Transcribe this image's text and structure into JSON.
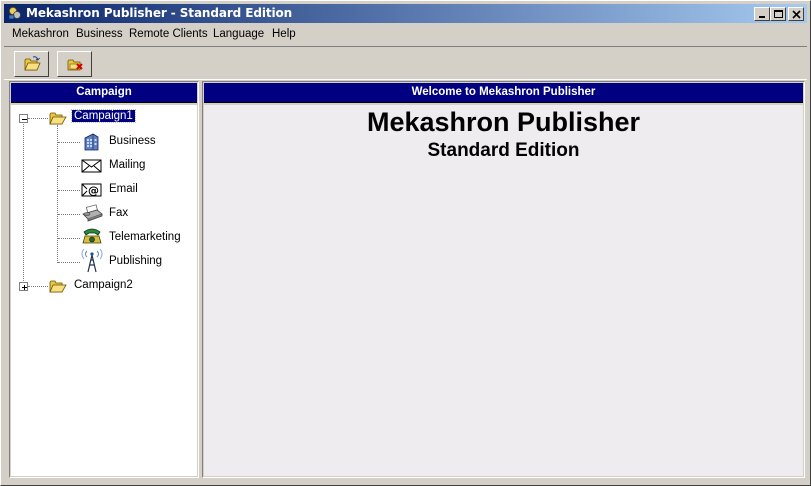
{
  "window": {
    "title": "Mekashron Publisher - Standard Edition"
  },
  "menu": {
    "items": [
      "Mekashron",
      "Business",
      "Remote Clients",
      "Language",
      "Help"
    ]
  },
  "toolbar": {
    "buttons": [
      {
        "icon": "open-folder-icon"
      },
      {
        "icon": "delete-folder-icon"
      }
    ]
  },
  "left_panel": {
    "header": "Campaign",
    "tree": {
      "campaign1": {
        "label": "Campaign1",
        "expanded": true,
        "children": [
          "Business",
          "Mailing",
          "Email",
          "Fax",
          "Telemarketing",
          "Publishing"
        ]
      },
      "campaign2": {
        "label": "Campaign2",
        "expanded": false
      }
    }
  },
  "right_panel": {
    "header": "Welcome to Mekashron Publisher",
    "heading": "Mekashron Publisher",
    "subheading": "Standard Edition"
  },
  "colors": {
    "title_gradient_start": "#0a246a",
    "title_gradient_end": "#a6caf0",
    "panel_header": "#000080",
    "face": "#d4d0c8"
  }
}
